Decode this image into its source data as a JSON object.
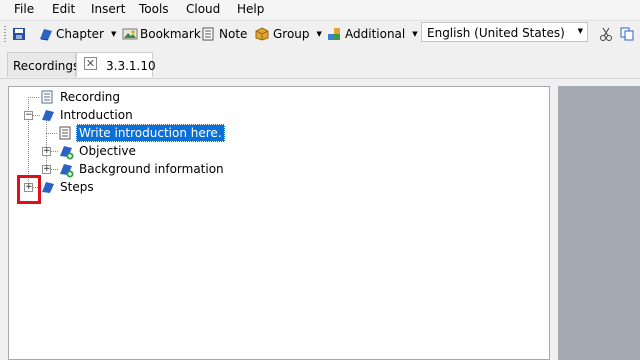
{
  "menu": [
    "File",
    "Edit",
    "Insert",
    "Tools",
    "Cloud",
    "Help"
  ],
  "toolbar": {
    "chapter": "Chapter",
    "bookmark": "Bookmark",
    "note": "Note",
    "group": "Group",
    "additional": "Additional",
    "language": "English (United States)"
  },
  "tabs": {
    "recordings": "Recordings",
    "active": "3.3.1.10"
  },
  "tree": {
    "recording": "Recording",
    "introduction": "Introduction",
    "intro_text": "Write introduction here.",
    "objective": "Objective",
    "background": "Background information",
    "steps": "Steps"
  },
  "colors": {
    "selection": "#0a6fd6",
    "highlight_box": "#e0101a",
    "right_pane": "#a3aab2"
  }
}
